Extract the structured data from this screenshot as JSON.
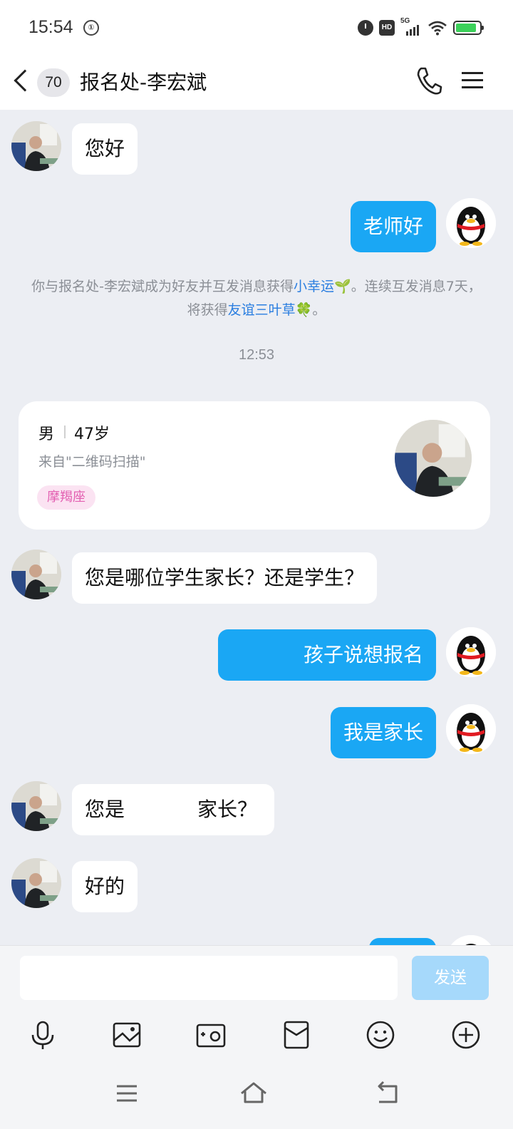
{
  "status_bar": {
    "time": "15:54",
    "left_icon": "①",
    "icons": [
      "alarm-icon",
      "hd-icon",
      "5g-signal-icon",
      "wifi-icon",
      "battery-icon"
    ],
    "network": "5G",
    "battery_color": "#3cd15a"
  },
  "header": {
    "unread_count": "70",
    "title": "报名处-李宏斌",
    "icons": [
      "back-chevron-icon",
      "phone-icon",
      "menu-icon"
    ]
  },
  "colors": {
    "outgoing_bubble": "#1aa7f4",
    "incoming_bubble": "#ffffff",
    "chat_background": "#eceef3",
    "link": "#2a7ee0",
    "tag_text": "#e35fb1"
  },
  "messages": [
    {
      "from": "contact",
      "text": "您好"
    },
    {
      "from": "me",
      "text": "老师好"
    },
    {
      "from": "system",
      "parts": [
        "你与报名处-李宏斌成为好友并互发消息获得",
        "小幸运",
        "🌱",
        "。连续互发消息7天，将获得",
        "友谊三叶草",
        "🍀",
        "。"
      ]
    },
    {
      "from": "time",
      "text": "12:53"
    },
    {
      "from": "profile_card",
      "gender": "男",
      "age": "47岁",
      "source": "来自\"二维码扫描\"",
      "tag": "摩羯座"
    },
    {
      "from": "contact",
      "text": "您是哪位学生家长？还是学生？"
    },
    {
      "from": "me",
      "text": "孩子说想报名"
    },
    {
      "from": "me",
      "text": "我是家长"
    },
    {
      "from": "contact",
      "text_start": "您是",
      "text_end": "家长？"
    },
    {
      "from": "contact",
      "text": "好的"
    }
  ],
  "input": {
    "value": "",
    "send_label": "发送"
  },
  "toolbar": [
    "microphone-icon",
    "image-icon",
    "camera-icon",
    "red-packet-icon",
    "emoji-icon",
    "plus-icon"
  ],
  "nav": [
    "recents-icon",
    "home-icon",
    "back-icon"
  ]
}
